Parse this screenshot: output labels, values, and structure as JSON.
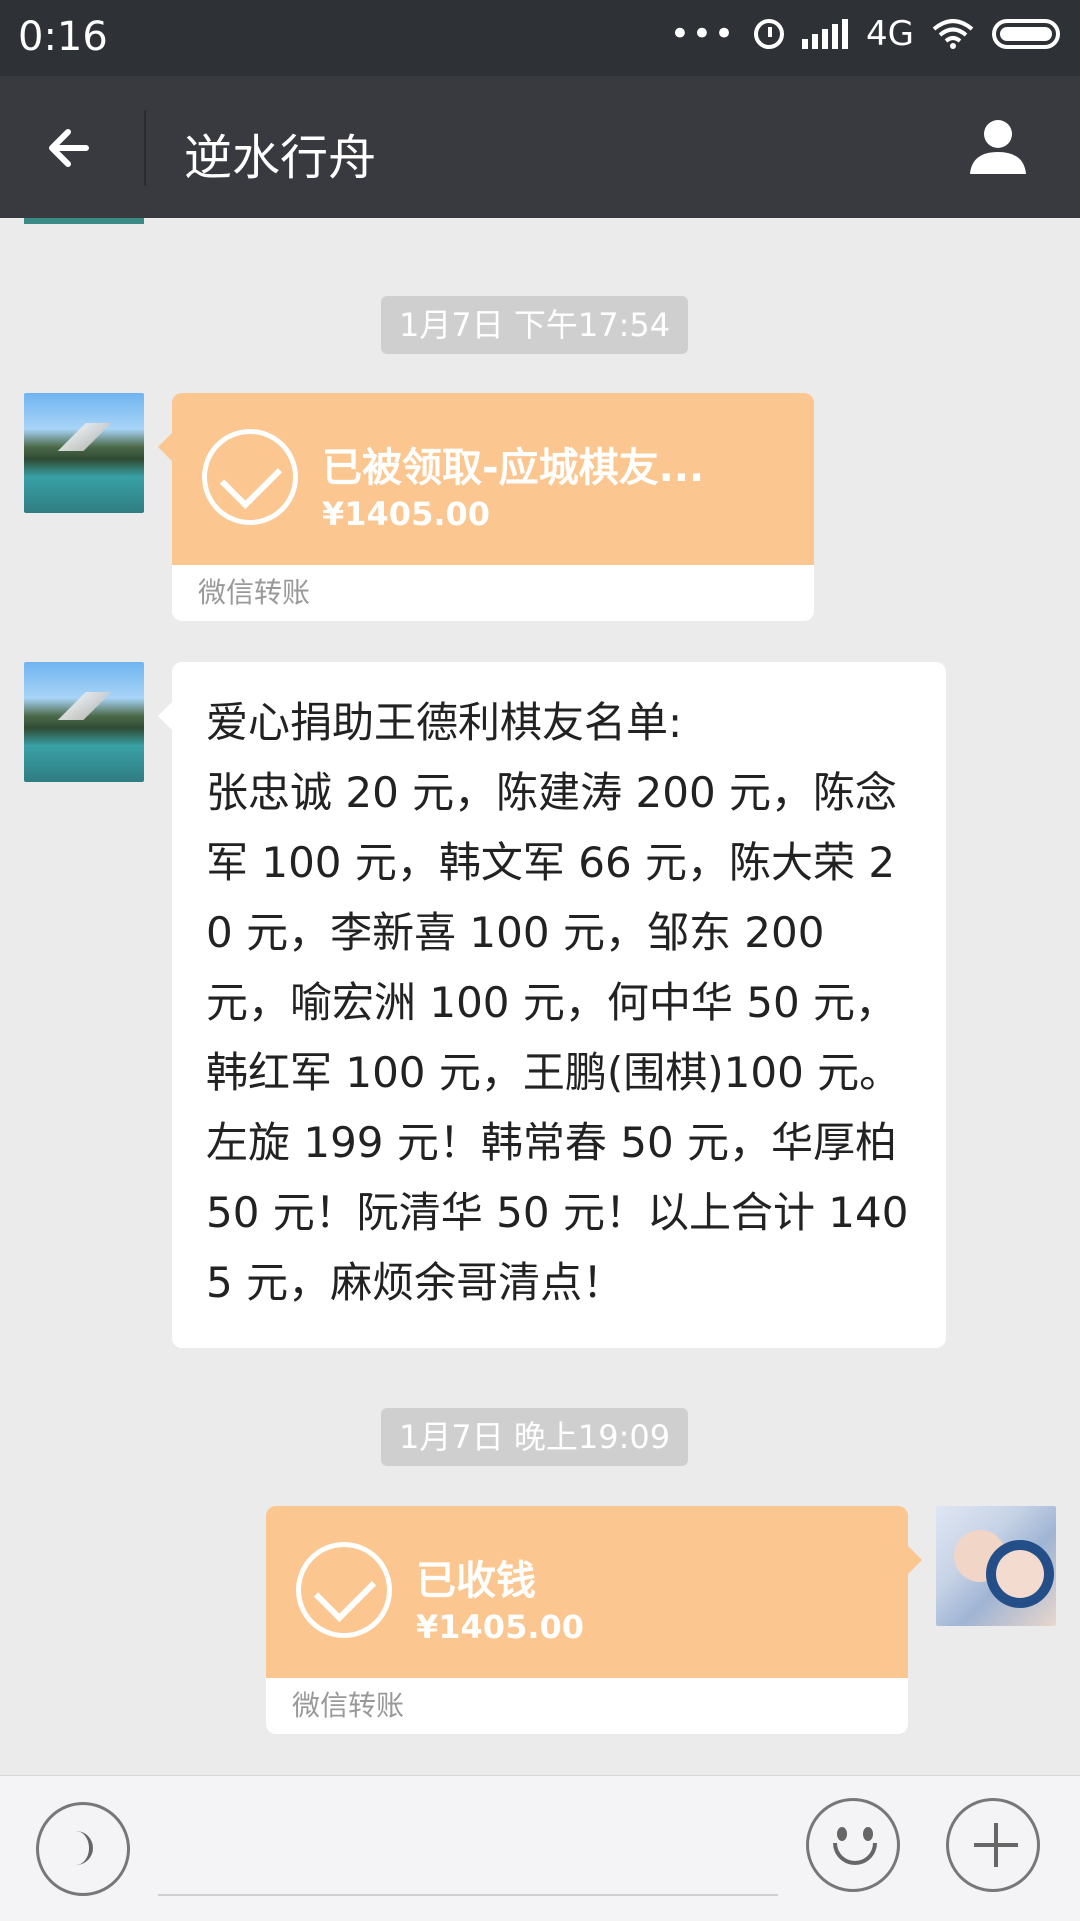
{
  "status_bar": {
    "time": "0:16",
    "network": "4G",
    "indicators": [
      "more-dots-icon",
      "alarm-icon",
      "signal-icon",
      "wifi-icon",
      "battery-icon"
    ]
  },
  "header": {
    "title": "逆水行舟",
    "back_icon": "back-arrow-icon",
    "profile_icon": "person-icon"
  },
  "chat": {
    "timestamps": [
      "1月7日 下午17:54",
      "1月7日 晚上19:09"
    ],
    "messages": [
      {
        "type": "transfer",
        "side": "left",
        "title": "已被领取-应城棋友...",
        "amount": "¥1405.00",
        "footer": "微信转账"
      },
      {
        "type": "text",
        "side": "left",
        "text": "爱心捐助王德利棋友名单:\n张忠诚 20 元，陈建涛 200 元，陈念军 100 元，韩文军 66 元，陈大荣 20 元，李新喜 100 元，邹东 200 元，喻宏洲 100 元，何中华 50 元，韩红军 100 元，王鹏(围棋)100 元。左旋 199 元！韩常春 50 元，华厚柏 50 元！阮清华 50 元！以上合计 1405 元，麻烦余哥清点！"
      },
      {
        "type": "transfer",
        "side": "right",
        "title": "已收钱",
        "amount": "¥1405.00",
        "footer": "微信转账"
      }
    ]
  },
  "input_bar": {
    "voice_icon": "voice-icon",
    "emoji_icon": "emoji-icon",
    "plus_icon": "plus-icon"
  },
  "colors": {
    "status_bar": "#2e3135",
    "header": "#393a3f",
    "transfer_orange": "#fbc68f",
    "chat_bg": "#ebebeb"
  }
}
